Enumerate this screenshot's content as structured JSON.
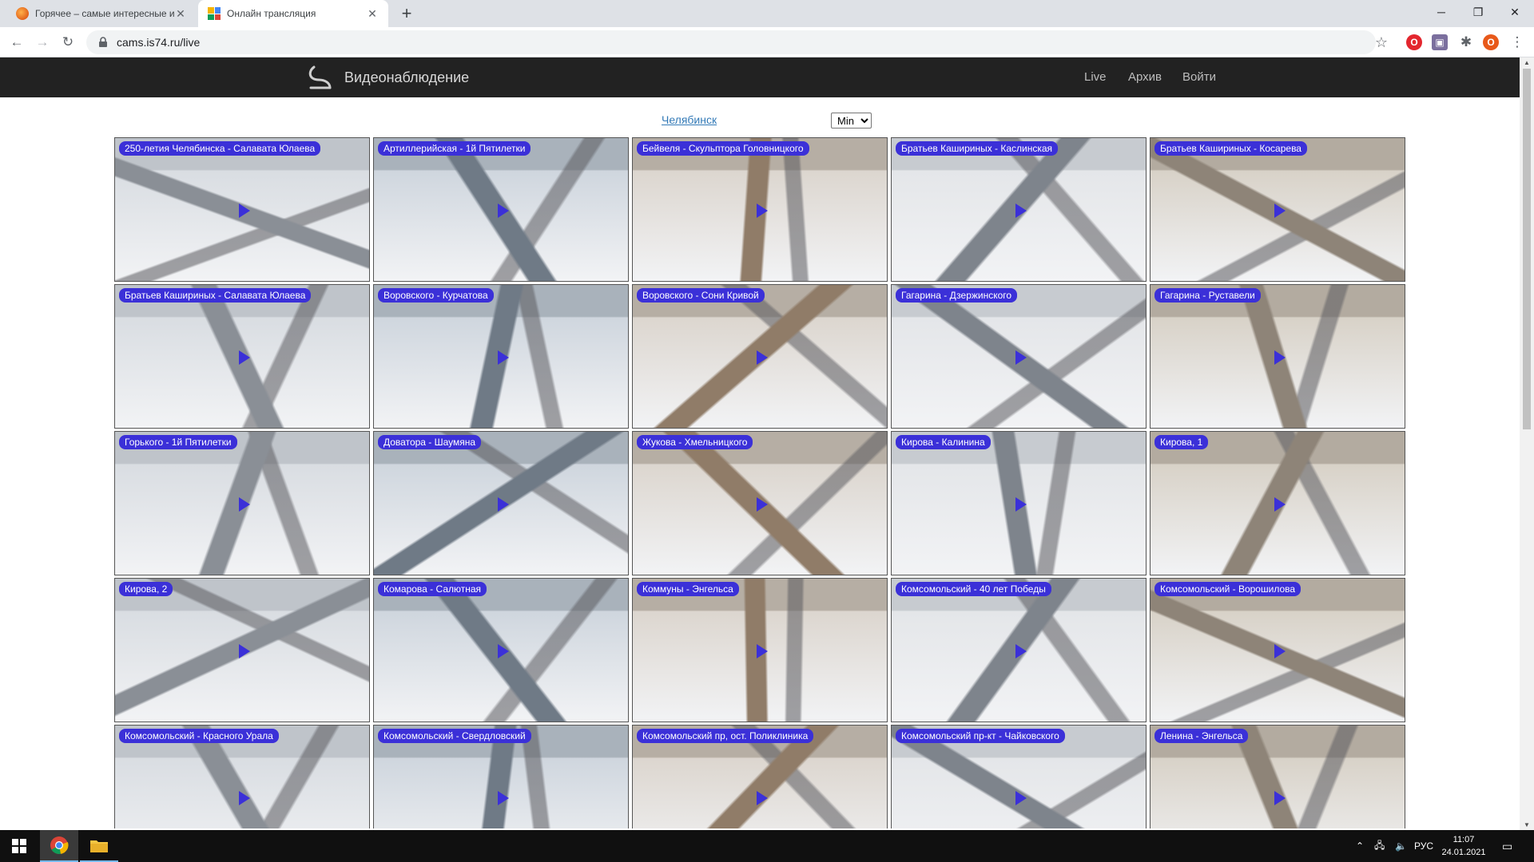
{
  "browser": {
    "tabs": [
      {
        "title": "Горячее – самые интересные и",
        "active": false
      },
      {
        "title": "Онлайн трансляция",
        "active": true
      }
    ],
    "url": "cams.is74.ru/live",
    "profile_initial": "O"
  },
  "site": {
    "brand": "Видеонаблюдение",
    "nav": [
      "Live",
      "Архив",
      "Войти"
    ],
    "city": "Челябинск",
    "size_options": [
      "Min"
    ],
    "size_selected": "Min"
  },
  "cameras": [
    "250-летия Челябинска - Салавата Юлаева",
    "Артиллерийская - 1й Пятилетки",
    "Бейвеля - Скульптора Головницкого",
    "Братьев Кашириных - Каслинская",
    "Братьев Кашириных - Косарева",
    "Братьев Кашириных - Салавата Юлаева",
    "Воровского - Курчатова",
    "Воровского - Сони Кривой",
    "Гагарина - Дзержинского",
    "Гагарина - Руставели",
    "Горького - 1й Пятилетки",
    "Доватора - Шаумяна",
    "Жукова - Хмельницкого",
    "Кирова - Калинина",
    "Кирова, 1",
    "Кирова, 2",
    "Комарова - Салютная",
    "Коммуны - Энгельса",
    "Комсомольский - 40 лет Победы",
    "Комсомольский - Ворошилова",
    "Комсомольский - Красного Урала",
    "Комсомольский - Свердловский",
    "Комсомольский пр, ост. Поликлиника",
    "Комсомольский пр-кт - Чайковского",
    "Ленина - Энгельса"
  ],
  "taskbar": {
    "language": "РУС",
    "time": "11:07",
    "date": "24.01.2021"
  },
  "colors": {
    "label_bg": "#3b30d8",
    "header_bg": "#222222",
    "link": "#337ab7"
  }
}
